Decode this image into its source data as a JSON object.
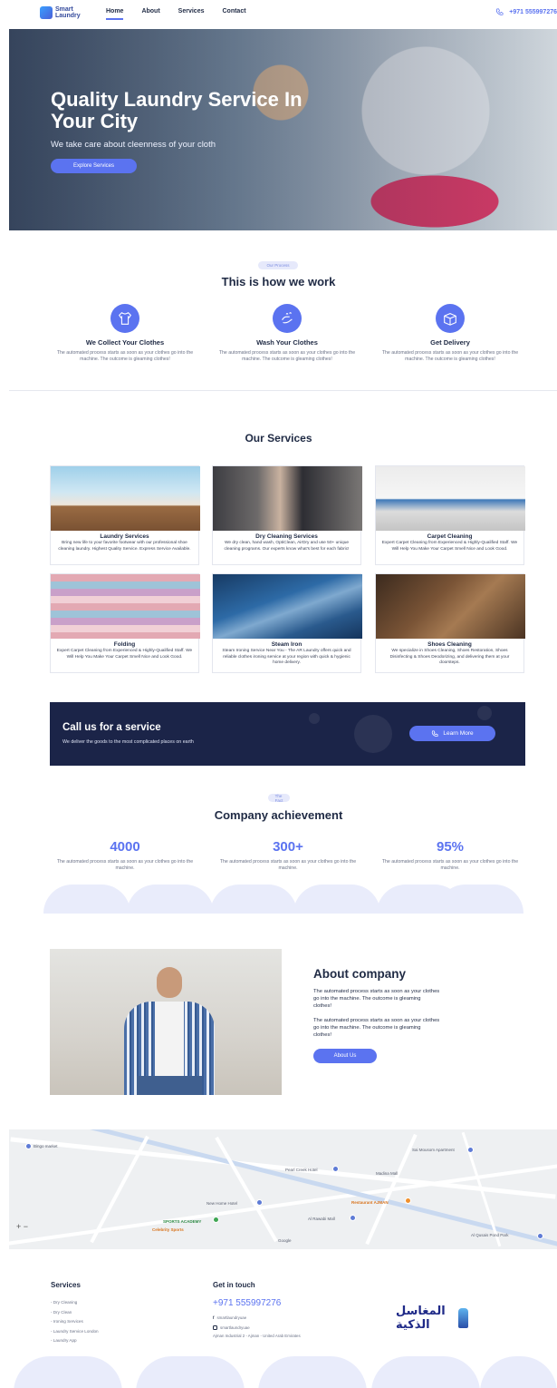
{
  "nav": {
    "logo_text": "Smart\nLaundry",
    "links": [
      "Home",
      "About",
      "Services",
      "Contact"
    ],
    "phone": "+971 555997276"
  },
  "hero": {
    "title": "Quality Laundry Service In Your City",
    "subtitle": "We take care about cleenness of your cloth",
    "button": "Explore Services"
  },
  "work": {
    "pill": "Our Process",
    "title": "This is how we work",
    "items": [
      {
        "title": "We Collect Your Clothes",
        "text": "The automated process starts as soon as your clothes go into the machine. The outcome is gleaming clothes!",
        "icon": "shirt-icon"
      },
      {
        "title": "Wash Your Clothes",
        "text": "The automated process starts as soon as your clothes go into the machine. The outcome is gleaming clothes!",
        "icon": "wash-hands-icon"
      },
      {
        "title": "Get Delivery",
        "text": "The automated process starts as soon as your clothes go into the machine. The outcome is gleaming clothes!",
        "icon": "box-icon"
      }
    ]
  },
  "services": {
    "title": "Our Services",
    "cards": [
      {
        "title": "Laundry Services",
        "text": "Bring new life to your favorite footwear with our professional shoe cleaning laundry. Highest Quality Service. Express Service Available."
      },
      {
        "title": "Dry Cleaning Services",
        "text": "We dry clean, hand wash, OptiClean, AirDry and use 50+ unique cleaning programs. Our experts know what's best for each fabric!"
      },
      {
        "title": "Carpet Cleaning",
        "text": "Expert Carpet Cleaning from Experienced & Highly-Qualified Staff. We Will Help You Make Your Carpet Smell Nice and Look Good."
      },
      {
        "title": "Folding",
        "text": "Expert Carpet Cleaning from Experienced & Highly-Qualified Staff. We Will Help You Make Your Carpet Smell Nice and Look Good."
      },
      {
        "title": "Steam Iron",
        "text": "Steam Ironing Service Near You - The AR Laundry offers quick and reliable clothes ironing service at your region with quick & hygienic home delivery."
      },
      {
        "title": "Shoes Cleaning",
        "text": "We specialize in Shoes Cleaning, Shoes Restoration, Shoes Disinfecting & Shoes Deodorizing, and delivering them at your doorsteps."
      }
    ]
  },
  "call": {
    "title": "Call us for a service",
    "subtitle": "We deliver the goods to the most complicated places on earth",
    "button": "Learn More"
  },
  "achievement": {
    "pill": "The Fact",
    "title": "Company achievement",
    "items": [
      {
        "value": "4000",
        "text": "The automated process starts as soon as your clothes go into the machine."
      },
      {
        "value": "300+",
        "text": "The automated process starts as soon as your clothes go into the machine."
      },
      {
        "value": "95%",
        "text": "The automated process starts as soon as your clothes go into the machine."
      }
    ]
  },
  "about": {
    "title": "About company",
    "para1": "The automated process starts as soon as your clothes go into the machine. The outcome is gleaming clothes!",
    "para2": "The automated process starts as soon as your clothes go into the machine. The outcome is gleaming clothes!",
    "button": "About Us"
  },
  "map": {
    "labels": [
      {
        "text": "Bingo market",
        "kind": ""
      },
      {
        "text": "Sai Mousom Apartment",
        "kind": ""
      },
      {
        "text": "Madina Mall",
        "kind": ""
      },
      {
        "text": "Pearl Creek Hotel",
        "kind": ""
      },
      {
        "text": "New Home Hotel",
        "kind": ""
      },
      {
        "text": "Al Rawabi Mall",
        "kind": ""
      },
      {
        "text": "Restaurant AJMAN",
        "kind": "o"
      },
      {
        "text": "SPORTS ACADEMY",
        "kind": "g"
      },
      {
        "text": "Celebrity Sports",
        "kind": "o"
      },
      {
        "text": "Google",
        "kind": ""
      },
      {
        "text": "Al Qusais Pond Park",
        "kind": ""
      }
    ]
  },
  "footer": {
    "services_title": "Services",
    "services": [
      "- Dry Cleaning",
      "- Dry Clean",
      "- Ironing Services",
      "- Laundry Service London",
      "- Laundry App"
    ],
    "contact_title": "Get in touch",
    "phone": "+971 555997276",
    "facebook": "smartlaundryuae",
    "instagram": "smartlaundryuae",
    "address": "Ajman Industrial 2 - Ajman - United Arab Emirates",
    "logo_text": "المغاسل الذكية"
  },
  "colors": {
    "accent": "#5b73f0",
    "dark_banner": "#1b2448",
    "text": "#1f2a44"
  }
}
